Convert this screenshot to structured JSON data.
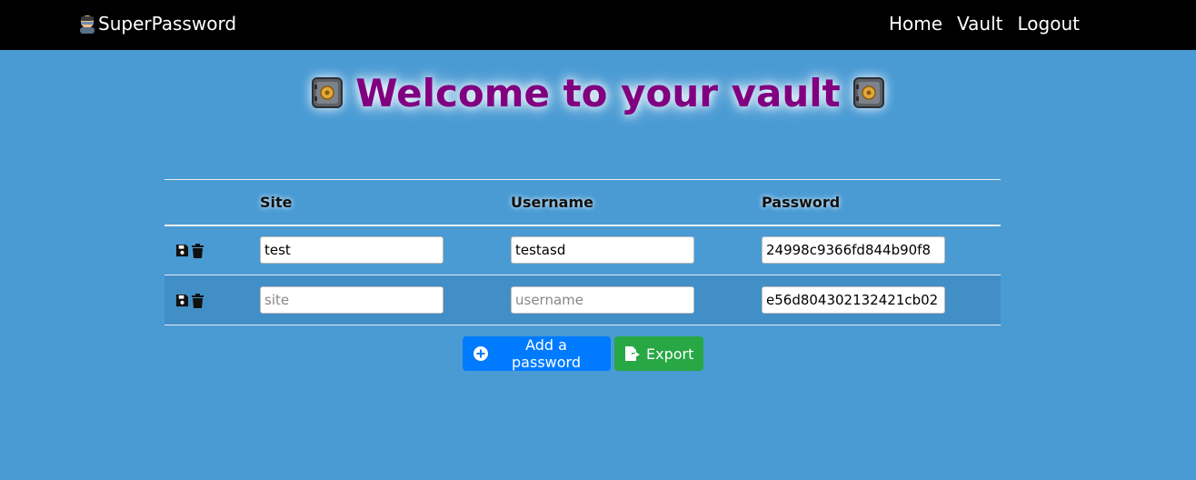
{
  "navbar": {
    "brand": "SuperPassword",
    "links": [
      "Home",
      "Vault",
      "Logout"
    ]
  },
  "title": {
    "text": "Welcome to your vault",
    "icon": "safe-icon"
  },
  "table": {
    "headers": [
      "Site",
      "Username",
      "Password"
    ],
    "rows": [
      {
        "site": "test",
        "site_placeholder": "site",
        "username": "testasd",
        "username_placeholder": "username",
        "password": "24998c9366fd844b90f8"
      },
      {
        "site": "",
        "site_placeholder": "site",
        "username": "",
        "username_placeholder": "username",
        "password": "e56d804302132421cb02"
      }
    ]
  },
  "buttons": {
    "add": "Add a password",
    "export": "Export"
  },
  "colors": {
    "navbar": "#000000",
    "background": "#4a9bd4",
    "title": "#800080",
    "add_button": "#007bff",
    "export_button": "#28a745"
  }
}
